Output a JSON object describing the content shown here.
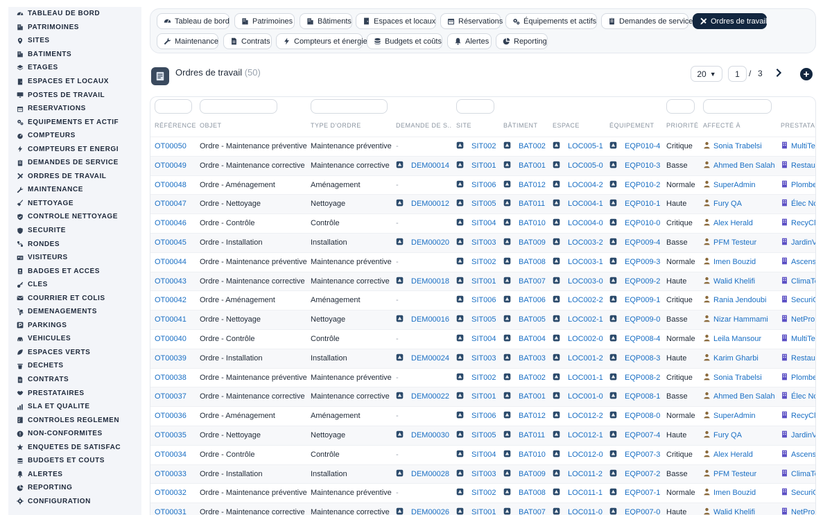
{
  "sidebar": {
    "items": [
      {
        "label": "TABLEAU DE BORD",
        "icon": "dashboard-icon"
      },
      {
        "label": "PATRIMOINES",
        "icon": "building-icon"
      },
      {
        "label": "SITES",
        "icon": "map-pin-icon"
      },
      {
        "label": "BÂTIMENTS",
        "icon": "building-icon"
      },
      {
        "label": "ÉTAGES",
        "icon": "layers-icon"
      },
      {
        "label": "ESPACES ET LOCAUX",
        "icon": "door-icon"
      },
      {
        "label": "POSTES DE TRAVAIL",
        "icon": "monitor-icon"
      },
      {
        "label": "RÉSERVATIONS",
        "icon": "calendar-icon"
      },
      {
        "label": "ÉQUIPEMENTS ET ACTIF",
        "icon": "gears-icon"
      },
      {
        "label": "COMPTEURS",
        "icon": "gauge-icon"
      },
      {
        "label": "COMPTEURS ET ÉNERGI",
        "icon": "bolt-icon"
      },
      {
        "label": "DEMANDES DE SERVICE",
        "icon": "clipboard-icon"
      },
      {
        "label": "ORDRES DE TRAVAIL",
        "icon": "tools-icon"
      },
      {
        "label": "MAINTENANCE",
        "icon": "wrench-icon"
      },
      {
        "label": "NETTOYAGE",
        "icon": "broom-icon"
      },
      {
        "label": "CONTRÔLE NETTOYAGE",
        "icon": "check-shield-icon"
      },
      {
        "label": "SÉCURITÉ",
        "icon": "shield-icon"
      },
      {
        "label": "RONDES",
        "icon": "route-icon"
      },
      {
        "label": "VISITEURS",
        "icon": "id-card-icon"
      },
      {
        "label": "BADGES ET ACCÈS",
        "icon": "badge-icon"
      },
      {
        "label": "CLÉS",
        "icon": "key-icon"
      },
      {
        "label": "COURRIER ET COLIS",
        "icon": "mail-icon"
      },
      {
        "label": "DÉMÉNAGEMENTS",
        "icon": "dolly-icon"
      },
      {
        "label": "PARKINGS",
        "icon": "parking-icon"
      },
      {
        "label": "VÉHICULES",
        "icon": "car-icon"
      },
      {
        "label": "ESPACES VERTS",
        "icon": "leaf-icon"
      },
      {
        "label": "DÉCHETS",
        "icon": "trash-icon"
      },
      {
        "label": "CONTRATS",
        "icon": "file-icon"
      },
      {
        "label": "PRESTATAIRES",
        "icon": "handshake-icon"
      },
      {
        "label": "SLA ET QUALITÉ",
        "icon": "chart-icon"
      },
      {
        "label": "CONTRÔLES RÉGLEMEN",
        "icon": "checklist-icon"
      },
      {
        "label": "NON-CONFORMITÉS",
        "icon": "alert-circle-icon"
      },
      {
        "label": "ENQUÊTES DE SATISFAC",
        "icon": "star-icon"
      },
      {
        "label": "BUDGETS ET COÛTS",
        "icon": "coins-icon"
      },
      {
        "label": "ALERTES",
        "icon": "bell-icon"
      },
      {
        "label": "REPORTING",
        "icon": "pie-icon"
      },
      {
        "label": "CONFIGURATION",
        "icon": "gear-icon"
      }
    ]
  },
  "tabs": [
    {
      "label": "Tableau de bord",
      "icon": "dashboard-icon",
      "active": false
    },
    {
      "label": "Patrimoines",
      "icon": "building-icon",
      "active": false
    },
    {
      "label": "Bâtiments",
      "icon": "building-icon",
      "active": false
    },
    {
      "label": "Espaces et locaux",
      "icon": "door-icon",
      "active": false
    },
    {
      "label": "Réservations",
      "icon": "calendar-icon",
      "active": false
    },
    {
      "label": "Équipements et actifs",
      "icon": "gears-icon",
      "active": false
    },
    {
      "label": "Demandes de service",
      "icon": "clipboard-icon",
      "active": false
    },
    {
      "label": "Ordres de travail",
      "icon": "tools-icon",
      "active": true
    },
    {
      "label": "Maintenance",
      "icon": "wrench-icon",
      "active": false
    },
    {
      "label": "Contrats",
      "icon": "file-icon",
      "active": false
    },
    {
      "label": "Compteurs et énergie",
      "icon": "bolt-icon",
      "active": false
    },
    {
      "label": "Budgets et coûts",
      "icon": "coins-icon",
      "active": false
    },
    {
      "label": "Alertes",
      "icon": "bell-icon",
      "active": false
    },
    {
      "label": "Reporting",
      "icon": "pie-icon",
      "active": false
    }
  ],
  "header": {
    "title": "Ordres de travail",
    "count": "(50)",
    "page_size": "20",
    "page": "1",
    "page_sep": "/",
    "total_pages": "3"
  },
  "table": {
    "columns": [
      "RÉFÉRENCE",
      "OBJET",
      "TYPE D'ORDRE",
      "DEMANDE DE S...",
      "SITE",
      "BÂTIMENT",
      "ESPACE",
      "ÉQUIPEMENT",
      "PRIORITÉ",
      "AFFECTÉ À",
      "PRESTATAIR"
    ],
    "rows": [
      [
        "OT00050",
        "Ordre - Maintenance préventive",
        "Maintenance préventive",
        "-",
        "SIT002",
        "BAT002",
        "LOC005-1",
        "EQP010-4",
        "Critique",
        "Sonia Trabelsi",
        "MultiTec"
      ],
      [
        "OT00049",
        "Ordre - Maintenance corrective",
        "Maintenance corrective",
        "DEM00014",
        "SIT001",
        "BAT001",
        "LOC005-0",
        "EQP010-3",
        "Basse",
        "Ahmed Ben Salah",
        "Restaur"
      ],
      [
        "OT00048",
        "Ordre - Aménagement",
        "Aménagement",
        "-",
        "SIT006",
        "BAT012",
        "LOC004-2",
        "EQP010-2",
        "Normale",
        "SuperAdmin",
        "Plombe"
      ],
      [
        "OT00047",
        "Ordre - Nettoyage",
        "Nettoyage",
        "DEM00012",
        "SIT005",
        "BAT011",
        "LOC004-1",
        "EQP010-1",
        "Haute",
        "Fury QA",
        "Élec No"
      ],
      [
        "OT00046",
        "Ordre - Contrôle",
        "Contrôle",
        "-",
        "SIT004",
        "BAT010",
        "LOC004-0",
        "EQP010-0",
        "Critique",
        "Alex Herald",
        "RecyCle"
      ],
      [
        "OT00045",
        "Ordre - Installation",
        "Installation",
        "DEM00020",
        "SIT003",
        "BAT009",
        "LOC003-2",
        "EQP009-4",
        "Basse",
        "PFM Testeur",
        "JardinV"
      ],
      [
        "OT00044",
        "Ordre - Maintenance préventive",
        "Maintenance préventive",
        "-",
        "SIT002",
        "BAT008",
        "LOC003-1",
        "EQP009-3",
        "Normale",
        "Imen Bouzid",
        "Ascens"
      ],
      [
        "OT00043",
        "Ordre - Maintenance corrective",
        "Maintenance corrective",
        "DEM00018",
        "SIT001",
        "BAT007",
        "LOC003-0",
        "EQP009-2",
        "Haute",
        "Walid Khelifi",
        "ClimaTe"
      ],
      [
        "OT00042",
        "Ordre - Aménagement",
        "Aménagement",
        "-",
        "SIT006",
        "BAT006",
        "LOC002-2",
        "EQP009-1",
        "Critique",
        "Rania Jendoubi",
        "SecuriG"
      ],
      [
        "OT00041",
        "Ordre - Nettoyage",
        "Nettoyage",
        "DEM00016",
        "SIT005",
        "BAT005",
        "LOC002-1",
        "EQP009-0",
        "Basse",
        "Nizar Hammami",
        "NetPro"
      ],
      [
        "OT00040",
        "Ordre - Contrôle",
        "Contrôle",
        "-",
        "SIT004",
        "BAT004",
        "LOC002-0",
        "EQP008-4",
        "Normale",
        "Leila Mansour",
        "MultiTec"
      ],
      [
        "OT00039",
        "Ordre - Installation",
        "Installation",
        "DEM00024",
        "SIT003",
        "BAT003",
        "LOC001-2",
        "EQP008-3",
        "Haute",
        "Karim Gharbi",
        "Restaur"
      ],
      [
        "OT00038",
        "Ordre - Maintenance préventive",
        "Maintenance préventive",
        "-",
        "SIT002",
        "BAT002",
        "LOC001-1",
        "EQP008-2",
        "Critique",
        "Sonia Trabelsi",
        "Plombe"
      ],
      [
        "OT00037",
        "Ordre - Maintenance corrective",
        "Maintenance corrective",
        "DEM00022",
        "SIT001",
        "BAT001",
        "LOC001-0",
        "EQP008-1",
        "Basse",
        "Ahmed Ben Salah",
        "Élec No"
      ],
      [
        "OT00036",
        "Ordre - Aménagement",
        "Aménagement",
        "-",
        "SIT006",
        "BAT012",
        "LOC012-2",
        "EQP008-0",
        "Normale",
        "SuperAdmin",
        "RecyCle"
      ],
      [
        "OT00035",
        "Ordre - Nettoyage",
        "Nettoyage",
        "DEM00030",
        "SIT005",
        "BAT011",
        "LOC012-1",
        "EQP007-4",
        "Haute",
        "Fury QA",
        "JardinV"
      ],
      [
        "OT00034",
        "Ordre - Contrôle",
        "Contrôle",
        "-",
        "SIT004",
        "BAT010",
        "LOC012-0",
        "EQP007-3",
        "Critique",
        "Alex Herald",
        "Ascens"
      ],
      [
        "OT00033",
        "Ordre - Installation",
        "Installation",
        "DEM00028",
        "SIT003",
        "BAT009",
        "LOC011-2",
        "EQP007-2",
        "Basse",
        "PFM Testeur",
        "ClimaTe"
      ],
      [
        "OT00032",
        "Ordre - Maintenance préventive",
        "Maintenance préventive",
        "-",
        "SIT002",
        "BAT008",
        "LOC011-1",
        "EQP007-1",
        "Normale",
        "Imen Bouzid",
        "SecuriG"
      ],
      [
        "OT00031",
        "Ordre - Maintenance corrective",
        "Maintenance corrective",
        "DEM00026",
        "SIT001",
        "BAT007",
        "LOC011-0",
        "EQP007-0",
        "Haute",
        "Walid Khelifi",
        "NetPro"
      ]
    ]
  },
  "colors": {
    "sidebar_bg": "#f3f5f9",
    "accent_dark": "#12263f",
    "link": "#1a6fc4",
    "muted": "#8b95a1",
    "person_icon": "#8a6a3c",
    "provider_icon": "#5b4fc4"
  }
}
